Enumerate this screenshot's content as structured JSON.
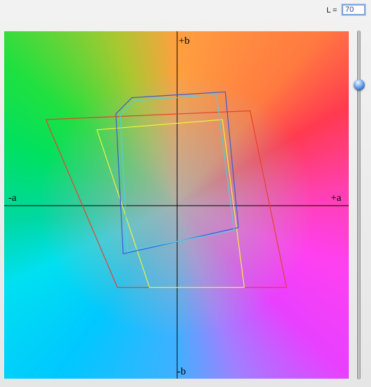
{
  "lightness": {
    "label": "L =",
    "value": "70",
    "min": 0,
    "max": 100
  },
  "axes": {
    "plus_a": "+a",
    "minus_a": "-a",
    "plus_b": "+b",
    "minus_b": "-b"
  },
  "gamuts": [
    {
      "color": "#e8402a",
      "points": [
        [
          -90,
          59
        ],
        [
          50,
          65
        ],
        [
          75,
          -56
        ],
        [
          -41,
          -56
        ]
      ]
    },
    {
      "color": "#f2f23a",
      "points": [
        [
          -55,
          52
        ],
        [
          31,
          59
        ],
        [
          46,
          -56
        ],
        [
          -19,
          -56
        ]
      ]
    },
    {
      "color": "#3a5ad8",
      "points": [
        [
          -42,
          63
        ],
        [
          -31,
          74
        ],
        [
          33,
          78
        ],
        [
          42,
          -15
        ],
        [
          -37,
          -33
        ]
      ]
    },
    {
      "color": "#50d0e0",
      "points": [
        [
          -39,
          62
        ],
        [
          -29,
          72
        ],
        [
          27,
          76
        ],
        [
          39,
          -17
        ],
        [
          -34,
          -31
        ]
      ]
    }
  ],
  "colors": {
    "accent": "#2f6fc8",
    "field_border": "#7fa7dd"
  }
}
